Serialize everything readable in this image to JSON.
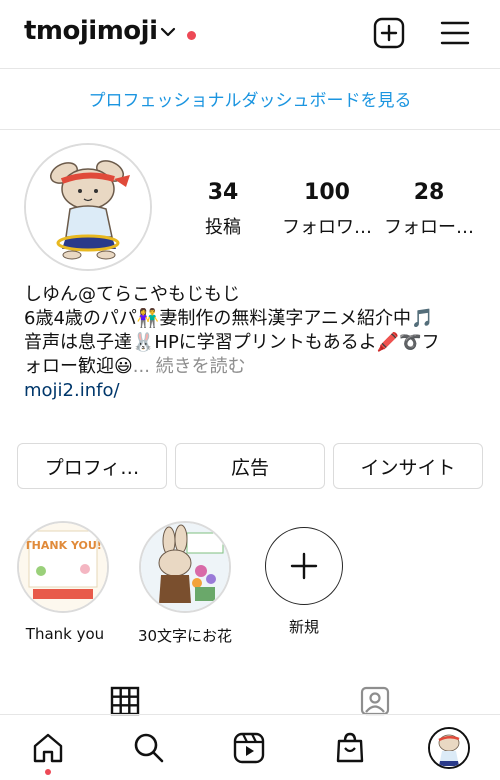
{
  "header": {
    "username": "tmojimoji",
    "icons": [
      "chevron-down-icon",
      "notification-dot",
      "add-post-icon",
      "menu-icon"
    ],
    "dot_color": "#ed4956"
  },
  "dashboard_link": "プロフェッショナルダッシュボードを見る",
  "stats": [
    {
      "value": "34",
      "label": "投稿"
    },
    {
      "value": "100",
      "label": "フォロワ…"
    },
    {
      "value": "28",
      "label": "フォロー…"
    }
  ],
  "bio": {
    "name": "しゆん@てらこやもじもじ",
    "line2": "6歳4歳のパパ👫妻制作の無料漢字アニメ紹介中🎵",
    "line3": "音声は息子達🐰HPに学習プリントもあるよ🖍️➰フ",
    "line4": "ォロー歓迎😃",
    "more_ellipsis": "...",
    "more": "続きを読む",
    "link": "moji2.info/"
  },
  "buttons": {
    "profile": "プロフィ…",
    "ads": "広告",
    "insights": "インサイト"
  },
  "highlights": [
    {
      "label": "Thank you",
      "thumb_text": "THANK YOU!"
    },
    {
      "label": "30文字にお花"
    },
    {
      "label": "新規"
    }
  ],
  "tabs": [
    "grid-icon",
    "tagged-icon"
  ],
  "bottom_nav": [
    "home-icon",
    "search-icon",
    "reels-icon",
    "shop-icon",
    "profile-avatar"
  ],
  "colors": {
    "link": "#1b95e0",
    "bio_link": "#00376b",
    "accent_red": "#ed4956"
  }
}
